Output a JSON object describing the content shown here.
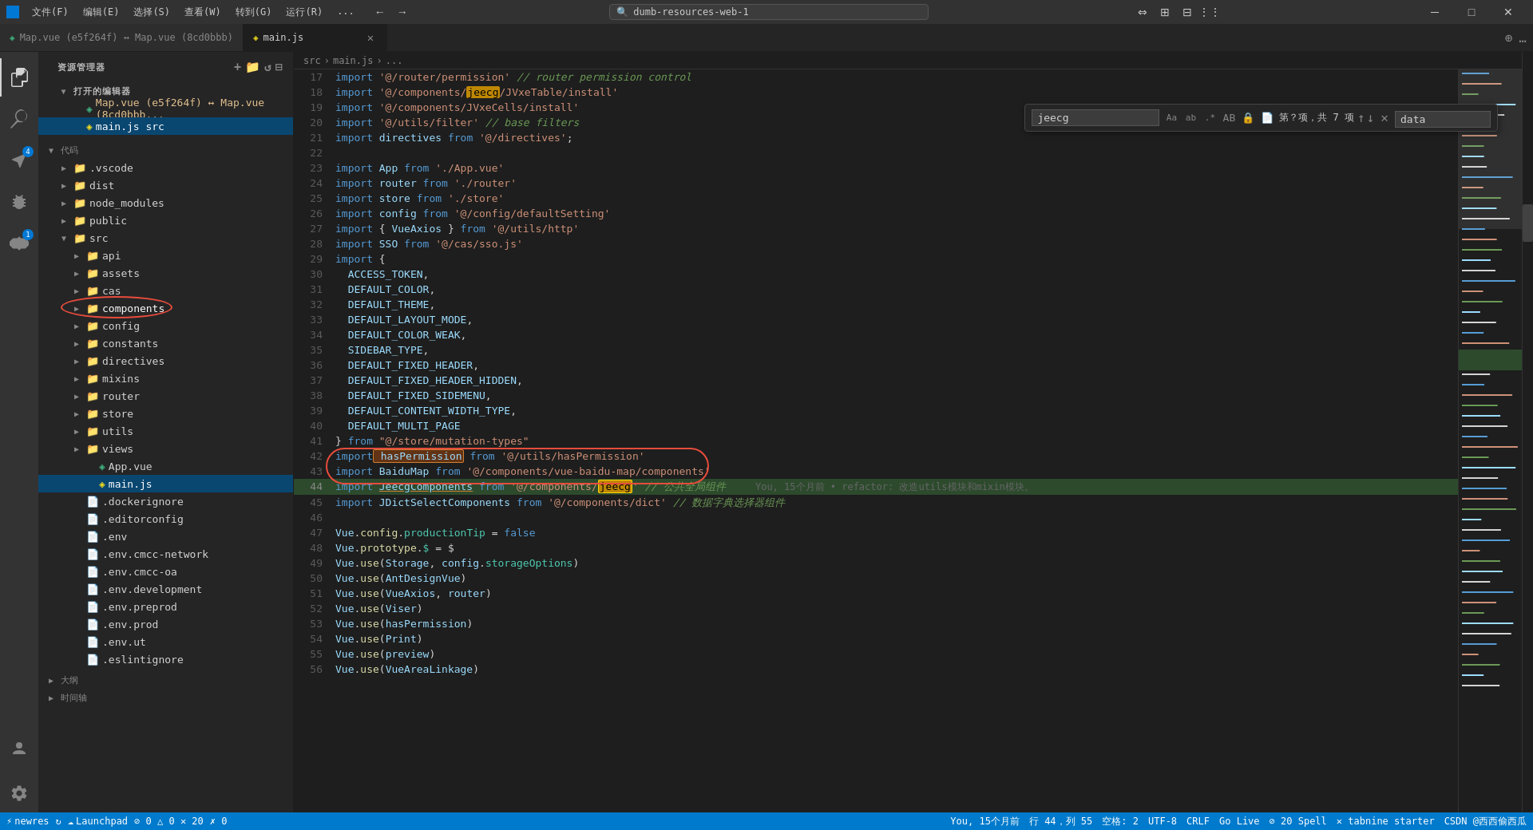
{
  "titleBar": {
    "appIcon": "V",
    "menuItems": [
      "文件(F)",
      "编辑(E)",
      "选择(S)",
      "查看(W)",
      "转到(G)",
      "运行(R)",
      "..."
    ],
    "addressBar": "dumb-resources-web-1",
    "windowControls": [
      "─",
      "□",
      "✕"
    ]
  },
  "tabs": [
    {
      "label": "Map.vue (e5f264f) ↔ Map.vue (8cd0bbb)",
      "type": "diff",
      "color": "#42b883",
      "active": false,
      "closeable": false
    },
    {
      "label": "main.js",
      "type": "js",
      "color": "#f7df1e",
      "active": true,
      "closeable": true
    }
  ],
  "breadcrumb": {
    "items": [
      "src",
      ">",
      "main.js",
      ">",
      "..."
    ]
  },
  "sidebar": {
    "title": "资源管理器",
    "openEditors": "打开的编辑器",
    "sections": [
      {
        "name": "打开的编辑器",
        "items": [
          {
            "label": "Map.vue (e5f264f) ↔ Map.vue (8cd0bbb...",
            "icon": "vue",
            "git": "modified"
          },
          {
            "label": "main.js src",
            "icon": "js",
            "active": true
          }
        ]
      }
    ],
    "fileTree": [
      {
        "label": "代码",
        "type": "section",
        "indent": 0,
        "expanded": false
      },
      {
        "label": ".vscode",
        "type": "folder",
        "indent": 1,
        "expanded": false
      },
      {
        "label": "dist",
        "type": "folder",
        "indent": 1,
        "expanded": false
      },
      {
        "label": "node_modules",
        "type": "folder",
        "indent": 1,
        "expanded": false
      },
      {
        "label": "public",
        "type": "folder",
        "indent": 1,
        "expanded": false
      },
      {
        "label": "src",
        "type": "folder",
        "indent": 1,
        "expanded": true
      },
      {
        "label": "api",
        "type": "folder",
        "indent": 2,
        "expanded": false
      },
      {
        "label": "assets",
        "type": "folder",
        "indent": 2,
        "expanded": false
      },
      {
        "label": "cas",
        "type": "folder",
        "indent": 2,
        "expanded": false
      },
      {
        "label": "components",
        "type": "folder",
        "indent": 2,
        "expanded": false,
        "circled": true
      },
      {
        "label": "config",
        "type": "folder",
        "indent": 2,
        "expanded": false
      },
      {
        "label": "constants",
        "type": "folder",
        "indent": 2,
        "expanded": false
      },
      {
        "label": "directives",
        "type": "folder",
        "indent": 2,
        "expanded": false
      },
      {
        "label": "mixins",
        "type": "folder",
        "indent": 2,
        "expanded": false
      },
      {
        "label": "router",
        "type": "folder",
        "indent": 2,
        "expanded": false
      },
      {
        "label": "store",
        "type": "folder",
        "indent": 2,
        "expanded": false
      },
      {
        "label": "utils",
        "type": "folder",
        "indent": 2,
        "expanded": false
      },
      {
        "label": "views",
        "type": "folder",
        "indent": 2,
        "expanded": false
      },
      {
        "label": "App.vue",
        "type": "vue",
        "indent": 3
      },
      {
        "label": "main.js",
        "type": "js",
        "indent": 3,
        "active": true
      },
      {
        "label": ".dockerignore",
        "type": "file",
        "indent": 2
      },
      {
        "label": ".editorconfig",
        "type": "file",
        "indent": 2
      },
      {
        "label": ".env",
        "type": "file",
        "indent": 2
      },
      {
        "label": ".env.cmcc-network",
        "type": "file",
        "indent": 2
      },
      {
        "label": ".env.cmcc-oa",
        "type": "file",
        "indent": 2
      },
      {
        "label": ".env.development",
        "type": "file",
        "indent": 2
      },
      {
        "label": ".env.preprod",
        "type": "file",
        "indent": 2
      },
      {
        "label": ".env.prod",
        "type": "file",
        "indent": 2
      },
      {
        "label": ".env.ut",
        "type": "file",
        "indent": 2
      },
      {
        "label": ".eslintignore",
        "type": "file",
        "indent": 2
      },
      {
        "label": "大纲",
        "type": "section",
        "indent": 0
      },
      {
        "label": "时间轴",
        "type": "section",
        "indent": 0
      }
    ]
  },
  "searchBar": {
    "searchValue": "jeecg",
    "replaceValue": "data",
    "matchCase": "Aa",
    "matchWord": "ab",
    "regex": ".*",
    "preserve": "",
    "count": "第？项，共 7 项",
    "closeLabel": "✕"
  },
  "codeLines": [
    {
      "num": 17,
      "content": "import '@/router/permission' // router permission control",
      "type": "import-cmt"
    },
    {
      "num": 18,
      "content": "import '@/components/jeecg/JVxeTable/install'",
      "type": "import-str"
    },
    {
      "num": 19,
      "content": "import '@/components/JVxeCells/install'",
      "type": "import-str"
    },
    {
      "num": 20,
      "content": "import '@/utils/filter' // base filters",
      "type": "import-cmt"
    },
    {
      "num": 21,
      "content": "import directives from '@/directives';",
      "type": "import"
    },
    {
      "num": 22,
      "content": ""
    },
    {
      "num": 23,
      "content": "import App from './App.vue'"
    },
    {
      "num": 24,
      "content": "import router from './router'"
    },
    {
      "num": 25,
      "content": "import store from './store'"
    },
    {
      "num": 26,
      "content": "import config from '@/config/defaultSetting'"
    },
    {
      "num": 27,
      "content": "import { VueAxios } from '@/utils/http'"
    },
    {
      "num": 28,
      "content": "import SSO from '@/cas/sso.js'"
    },
    {
      "num": 29,
      "content": "import {"
    },
    {
      "num": 30,
      "content": "  ACCESS_TOKEN,"
    },
    {
      "num": 31,
      "content": "  DEFAULT_COLOR,"
    },
    {
      "num": 32,
      "content": "  DEFAULT_THEME,"
    },
    {
      "num": 33,
      "content": "  DEFAULT_LAYOUT_MODE,"
    },
    {
      "num": 34,
      "content": "  DEFAULT_COLOR_WEAK,"
    },
    {
      "num": 35,
      "content": "  SIDEBAR_TYPE,"
    },
    {
      "num": 36,
      "content": "  DEFAULT_FIXED_HEADER,"
    },
    {
      "num": 37,
      "content": "  DEFAULT_FIXED_HEADER_HIDDEN,"
    },
    {
      "num": 38,
      "content": "  DEFAULT_FIXED_SIDEMENU,"
    },
    {
      "num": 39,
      "content": "  DEFAULT_CONTENT_WIDTH_TYPE,"
    },
    {
      "num": 40,
      "content": "  DEFAULT_MULTI_PAGE"
    },
    {
      "num": 41,
      "content": "} from \"@/store/mutation-types\""
    },
    {
      "num": 42,
      "content": "import hasPermission from '@/utils/hasPermission'",
      "circle": true
    },
    {
      "num": 43,
      "content": "import BaiduMap from '@/components/vue-baidu-map/components'",
      "circle": true
    },
    {
      "num": 44,
      "content": "import JeecgComponents from '@/components/jeecg' // 公共全局组件",
      "highlight": true,
      "blame": "You, 15个月前 • refactor: 改造utils模块和mixin模块。"
    },
    {
      "num": 45,
      "content": "import JDictSelectComponents from '@/components/dict' // 数据字典选择器组件"
    },
    {
      "num": 46,
      "content": ""
    },
    {
      "num": 47,
      "content": "Vue.config.productionTip = false"
    },
    {
      "num": 48,
      "content": "Vue.prototype.$ = $"
    },
    {
      "num": 49,
      "content": "Vue.use(Storage, config.storageOptions)"
    },
    {
      "num": 50,
      "content": "Vue.use(AntDesignVue)"
    },
    {
      "num": 51,
      "content": "Vue.use(VueAxios, router)"
    },
    {
      "num": 52,
      "content": "Vue.use(Viser)"
    },
    {
      "num": 53,
      "content": "Vue.use(hasPermission)"
    },
    {
      "num": 54,
      "content": "Vue.use(Print)"
    },
    {
      "num": 55,
      "content": "Vue.use(preview)"
    },
    {
      "num": 56,
      "content": "Vue.use(VueAreaLinkage)"
    }
  ],
  "statusBar": {
    "left": [
      {
        "icon": "⚡",
        "label": "newres"
      },
      {
        "icon": "↻",
        "label": ""
      },
      {
        "icon": "☁",
        "label": "Launchpad"
      },
      {
        "label": "⊘ 0  △ 0  ✕ 20"
      },
      {
        "label": "✗ 0"
      }
    ],
    "right": [
      {
        "label": "You, 15个月前"
      },
      {
        "label": "行 44，列 55"
      },
      {
        "label": "空格: 2"
      },
      {
        "label": "UTF-8"
      },
      {
        "label": "CRLF"
      },
      {
        "label": "Go Live"
      },
      {
        "label": "⊘ 20 Spell"
      },
      {
        "label": "✕ tabnine starter"
      },
      {
        "label": "CSDN @西西偷西瓜"
      }
    ]
  }
}
